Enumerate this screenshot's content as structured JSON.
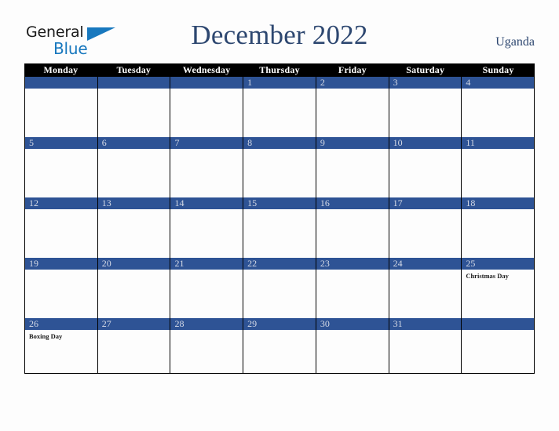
{
  "brand": {
    "name_line1": "General",
    "name_line2": "Blue",
    "triangle_icon": "blue-triangle-icon",
    "blue": "#1878be"
  },
  "header": {
    "title": "December 2022",
    "country": "Uganda",
    "title_color": "#2d4770"
  },
  "theme": {
    "accent_blue": "#2e5395",
    "header_bar": "#000000",
    "page_background": "#fdfdfd",
    "day_number_color": "#d5dae6"
  },
  "calendar": {
    "weekdays": [
      "Monday",
      "Tuesday",
      "Wednesday",
      "Thursday",
      "Friday",
      "Saturday",
      "Sunday"
    ],
    "weeks": [
      [
        {
          "day": "",
          "events": []
        },
        {
          "day": "",
          "events": []
        },
        {
          "day": "",
          "events": []
        },
        {
          "day": "1",
          "events": []
        },
        {
          "day": "2",
          "events": []
        },
        {
          "day": "3",
          "events": []
        },
        {
          "day": "4",
          "events": []
        }
      ],
      [
        {
          "day": "5",
          "events": []
        },
        {
          "day": "6",
          "events": []
        },
        {
          "day": "7",
          "events": []
        },
        {
          "day": "8",
          "events": []
        },
        {
          "day": "9",
          "events": []
        },
        {
          "day": "10",
          "events": []
        },
        {
          "day": "11",
          "events": []
        }
      ],
      [
        {
          "day": "12",
          "events": []
        },
        {
          "day": "13",
          "events": []
        },
        {
          "day": "14",
          "events": []
        },
        {
          "day": "15",
          "events": []
        },
        {
          "day": "16",
          "events": []
        },
        {
          "day": "17",
          "events": []
        },
        {
          "day": "18",
          "events": []
        }
      ],
      [
        {
          "day": "19",
          "events": []
        },
        {
          "day": "20",
          "events": []
        },
        {
          "day": "21",
          "events": []
        },
        {
          "day": "22",
          "events": []
        },
        {
          "day": "23",
          "events": []
        },
        {
          "day": "24",
          "events": []
        },
        {
          "day": "25",
          "events": [
            "Christmas Day"
          ]
        }
      ],
      [
        {
          "day": "26",
          "events": [
            "Boxing Day"
          ]
        },
        {
          "day": "27",
          "events": []
        },
        {
          "day": "28",
          "events": []
        },
        {
          "day": "29",
          "events": []
        },
        {
          "day": "30",
          "events": []
        },
        {
          "day": "31",
          "events": []
        },
        {
          "day": "",
          "events": []
        }
      ]
    ]
  }
}
